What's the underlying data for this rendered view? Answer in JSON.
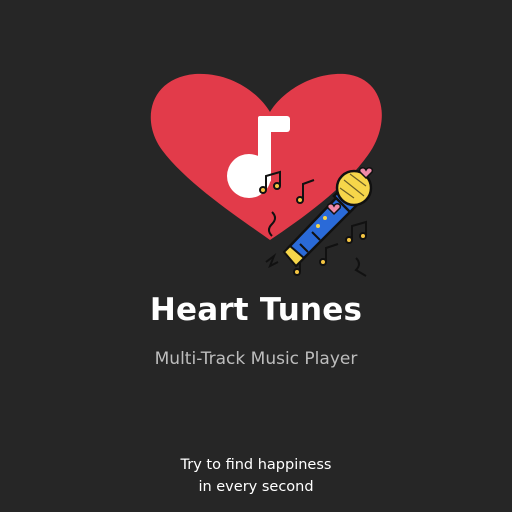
{
  "app": {
    "title": "Heart Tunes",
    "subtitle": "Multi-Track Music Player"
  },
  "tagline": {
    "line1": "Try to find happiness",
    "line2": "in every second"
  },
  "logo": {
    "icons": [
      "heart-icon",
      "music-note-icon",
      "microphone-icon"
    ],
    "colors": {
      "heart": "#e23b4a",
      "note": "#ffffff",
      "mic_body": "#2a6ad8",
      "mic_head": "#f6d64a",
      "accent_pink": "#f08aa8",
      "background": "#262626"
    }
  }
}
